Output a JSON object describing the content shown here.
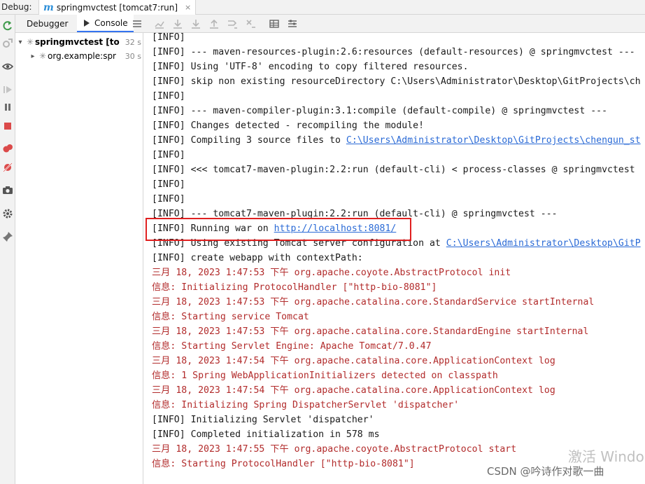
{
  "title_bar": {
    "debug_label": "Debug:",
    "run_tab_title": "springmvctest [tomcat7:run]",
    "close_glyph": "×"
  },
  "tabs": {
    "debugger": "Debugger",
    "console": "Console"
  },
  "frames": [
    {
      "label": "springmvctest [to",
      "duration": "32 s",
      "expanded": true
    },
    {
      "label": "org.example:spr",
      "duration": "30 s",
      "expanded": false
    }
  ],
  "console_lines": [
    {
      "text": "[INFO]",
      "color": "default"
    },
    {
      "text": "[INFO] --- maven-resources-plugin:2.6:resources (default-resources) @ springmvctest ---",
      "color": "default"
    },
    {
      "text": "[INFO] Using 'UTF-8' encoding to copy filtered resources.",
      "color": "default"
    },
    {
      "text": "[INFO] skip non existing resourceDirectory C:\\Users\\Administrator\\Desktop\\GitProjects\\ch",
      "color": "default"
    },
    {
      "text": "[INFO]",
      "color": "default"
    },
    {
      "text": "[INFO] --- maven-compiler-plugin:3.1:compile (default-compile) @ springmvctest ---",
      "color": "default"
    },
    {
      "text": "[INFO] Changes detected - recompiling the module!",
      "color": "default"
    },
    {
      "text": "[INFO] Compiling 3 source files to ",
      "link": "C:\\Users\\Administrator\\Desktop\\GitProjects\\chengun_st",
      "color": "default"
    },
    {
      "text": "[INFO]",
      "color": "default"
    },
    {
      "text": "[INFO] <<< tomcat7-maven-plugin:2.2:run (default-cli) < process-classes @ springmvctest",
      "color": "default"
    },
    {
      "text": "[INFO]",
      "color": "default"
    },
    {
      "text": "[INFO]",
      "color": "default"
    },
    {
      "text": "[INFO] --- tomcat7-maven-plugin:2.2:run (default-cli) @ springmvctest ---",
      "color": "default"
    },
    {
      "text": "[INFO] Running war on ",
      "link": "http://localhost:8081/",
      "color": "default"
    },
    {
      "text": "[INFO] Using existing Tomcat server configuration at ",
      "link": "C:\\Users\\Administrator\\Desktop\\GitP",
      "color": "default"
    },
    {
      "text": "[INFO] create webapp with contextPath:",
      "color": "default"
    },
    {
      "text": "三月 18, 2023 1:47:53 下午 org.apache.coyote.AbstractProtocol init",
      "color": "red"
    },
    {
      "text": "信息: Initializing ProtocolHandler [\"http-bio-8081\"]",
      "color": "red"
    },
    {
      "text": "三月 18, 2023 1:47:53 下午 org.apache.catalina.core.StandardService startInternal",
      "color": "red"
    },
    {
      "text": "信息: Starting service Tomcat",
      "color": "red"
    },
    {
      "text": "三月 18, 2023 1:47:53 下午 org.apache.catalina.core.StandardEngine startInternal",
      "color": "red"
    },
    {
      "text": "信息: Starting Servlet Engine: Apache Tomcat/7.0.47",
      "color": "red"
    },
    {
      "text": "三月 18, 2023 1:47:54 下午 org.apache.catalina.core.ApplicationContext log",
      "color": "red"
    },
    {
      "text": "信息: 1 Spring WebApplicationInitializers detected on classpath",
      "color": "red"
    },
    {
      "text": "三月 18, 2023 1:47:54 下午 org.apache.catalina.core.ApplicationContext log",
      "color": "red"
    },
    {
      "text": "信息: Initializing Spring DispatcherServlet 'dispatcher'",
      "color": "red"
    },
    {
      "text": "[INFO] Initializing Servlet 'dispatcher'",
      "color": "default"
    },
    {
      "text": "[INFO] Completed initialization in 578 ms",
      "color": "default"
    },
    {
      "text": "三月 18, 2023 1:47:55 下午 org.apache.coyote.AbstractProtocol start",
      "color": "red"
    },
    {
      "text": "信息: Starting ProtocolHandler [\"http-bio-8081\"]",
      "color": "red"
    }
  ],
  "overlay": {
    "watermark": "激活 Windo",
    "csdn": "CSDN @吟诗作对歌一曲"
  },
  "colors": {
    "accent": "#3574f0",
    "log_red": "#b22b2b",
    "link": "#2a6ad6",
    "highlight_box": "#e02020"
  }
}
